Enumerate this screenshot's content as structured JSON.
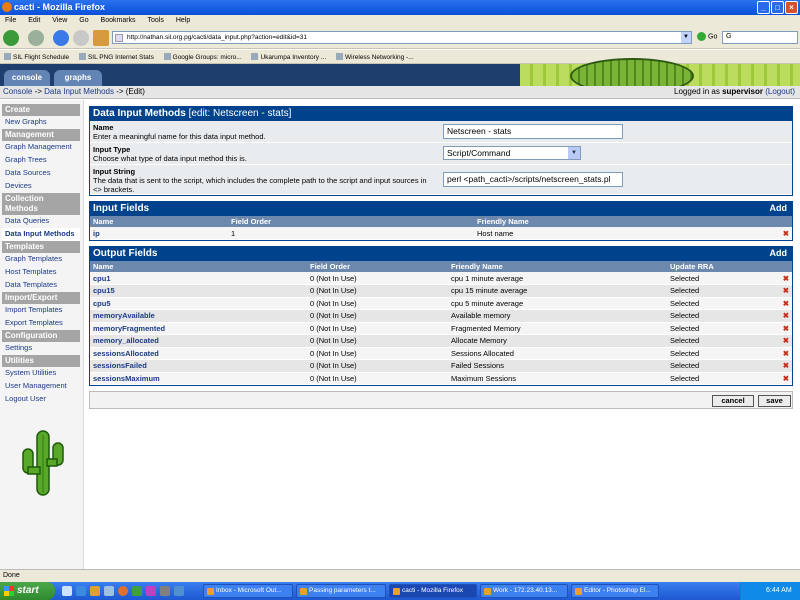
{
  "browser": {
    "title": "cacti - Mozilla Firefox",
    "menu": [
      "File",
      "Edit",
      "View",
      "Go",
      "Bookmarks",
      "Tools",
      "Help"
    ],
    "url": "http://nathan.sil.org.pg/cacti/data_input.php?action=edit&id=31",
    "go_label": "Go",
    "search_value": "G",
    "bookmarks": [
      "SIL Flight Schedule",
      "SIL PNG Internet Stats",
      "Google Groups: micro...",
      "Ukarumpa Inventory ...",
      "Wireless Networking -..."
    ],
    "status": "Done"
  },
  "tabs": {
    "console": "console",
    "graphs": "graphs"
  },
  "breadcrumb": {
    "console": "Console",
    "sep1": " -> ",
    "data_input": "Data Input Methods",
    "sep2": " -> (Edit)"
  },
  "login": {
    "prefix": "Logged in as ",
    "user": "supervisor",
    "logout": "(Logout)",
    "lparen": " ",
    "rparen": ""
  },
  "sidebar": {
    "create": "Create",
    "new_graphs": "New Graphs",
    "management": "Management",
    "graph_management": "Graph Management",
    "graph_trees": "Graph Trees",
    "data_sources": "Data Sources",
    "devices": "Devices",
    "collection": "Collection Methods",
    "data_queries": "Data Queries",
    "data_input_methods": "Data Input Methods",
    "templates": "Templates",
    "graph_templates": "Graph Templates",
    "host_templates": "Host Templates",
    "data_templates": "Data Templates",
    "import_export": "Import/Export",
    "import_templates": "Import Templates",
    "export_templates": "Export Templates",
    "configuration": "Configuration",
    "settings": "Settings",
    "utilities": "Utilities",
    "system_utilities": "System Utilities",
    "user_management": "User Management",
    "logout_user": "Logout User"
  },
  "dim": {
    "title": "Data Input Methods",
    "edit": "[edit: Netscreen - stats]",
    "name_label": "Name",
    "name_desc": "Enter a meaningful name for this data input method.",
    "name_value": "Netscreen - stats",
    "type_label": "Input Type",
    "type_desc": "Choose what type of data input method this is.",
    "type_value": "Script/Command",
    "string_label": "Input String",
    "string_desc": "The data that is sent to the script, which includes the complete path to the script and input sources in <> brackets.",
    "string_value": "perl <path_cacti>/scripts/netscreen_stats.pl"
  },
  "input_fields": {
    "title": "Input Fields",
    "add": "Add",
    "headers": {
      "name": "Name",
      "order": "Field Order",
      "friendly": "Friendly Name"
    },
    "rows": [
      {
        "name": "ip",
        "order": "1",
        "friendly": "Host name"
      }
    ]
  },
  "output_fields": {
    "title": "Output Fields",
    "add": "Add",
    "headers": {
      "name": "Name",
      "order": "Field Order",
      "friendly": "Friendly Name",
      "rra": "Update RRA"
    },
    "rows": [
      {
        "name": "cpu1",
        "order": "0 (Not In Use)",
        "friendly": "cpu 1 minute average",
        "rra": "Selected"
      },
      {
        "name": "cpu15",
        "order": "0 (Not In Use)",
        "friendly": "cpu 15 minute average",
        "rra": "Selected"
      },
      {
        "name": "cpu5",
        "order": "0 (Not In Use)",
        "friendly": "cpu 5 minute average",
        "rra": "Selected"
      },
      {
        "name": "memoryAvailable",
        "order": "0 (Not In Use)",
        "friendly": "Available memory",
        "rra": "Selected"
      },
      {
        "name": "memoryFragmented",
        "order": "0 (Not In Use)",
        "friendly": "Fragmented Memory",
        "rra": "Selected"
      },
      {
        "name": "memory_allocated",
        "order": "0 (Not In Use)",
        "friendly": "Allocate Memory",
        "rra": "Selected"
      },
      {
        "name": "sessionsAllocated",
        "order": "0 (Not In Use)",
        "friendly": "Sessions Allocated",
        "rra": "Selected"
      },
      {
        "name": "sessionsFailed",
        "order": "0 (Not In Use)",
        "friendly": "Failed Sessions",
        "rra": "Selected"
      },
      {
        "name": "sessionsMaximum",
        "order": "0 (Not In Use)",
        "friendly": "Maximum Sessions",
        "rra": "Selected"
      }
    ]
  },
  "buttons": {
    "cancel": "cancel",
    "save": "save"
  },
  "delete_glyph": "✖",
  "taskbar": {
    "start": "start",
    "tasks": [
      "Inbox - Microsoft Out...",
      "Passing parameters t...",
      "cacti - Mozilla Firefox",
      "Work - 172.23.40.13...",
      "Editor - Photoshop El..."
    ],
    "clock": "6:44 AM"
  }
}
